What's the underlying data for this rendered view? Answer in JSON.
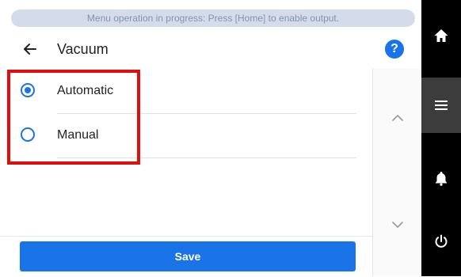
{
  "status_banner": "Menu operation in progress: Press [Home] to enable output.",
  "header": {
    "title": "Vacuum",
    "back_icon": "arrow-left-icon",
    "help_label": "?",
    "help_icon": "help-circle-icon"
  },
  "options": [
    {
      "label": "Automatic",
      "selected": true
    },
    {
      "label": "Manual",
      "selected": false
    }
  ],
  "footer": {
    "save_label": "Save"
  },
  "side_nav": {
    "items": [
      {
        "name": "home",
        "icon": "home-icon"
      },
      {
        "name": "menu",
        "icon": "hamburger-menu-icon",
        "active": true
      },
      {
        "name": "alerts",
        "icon": "bell-icon"
      },
      {
        "name": "power",
        "icon": "power-icon"
      }
    ]
  },
  "scroll": {
    "up_icon": "chevron-up-icon",
    "down_icon": "chevron-down-icon"
  },
  "colors": {
    "accent": "#1a73e8",
    "highlight": "#e10e0e",
    "banner_bg": "#d4dcec",
    "banner_text": "#8593ad",
    "nav_bg": "#000000",
    "nav_active": "#3c3c3c"
  }
}
